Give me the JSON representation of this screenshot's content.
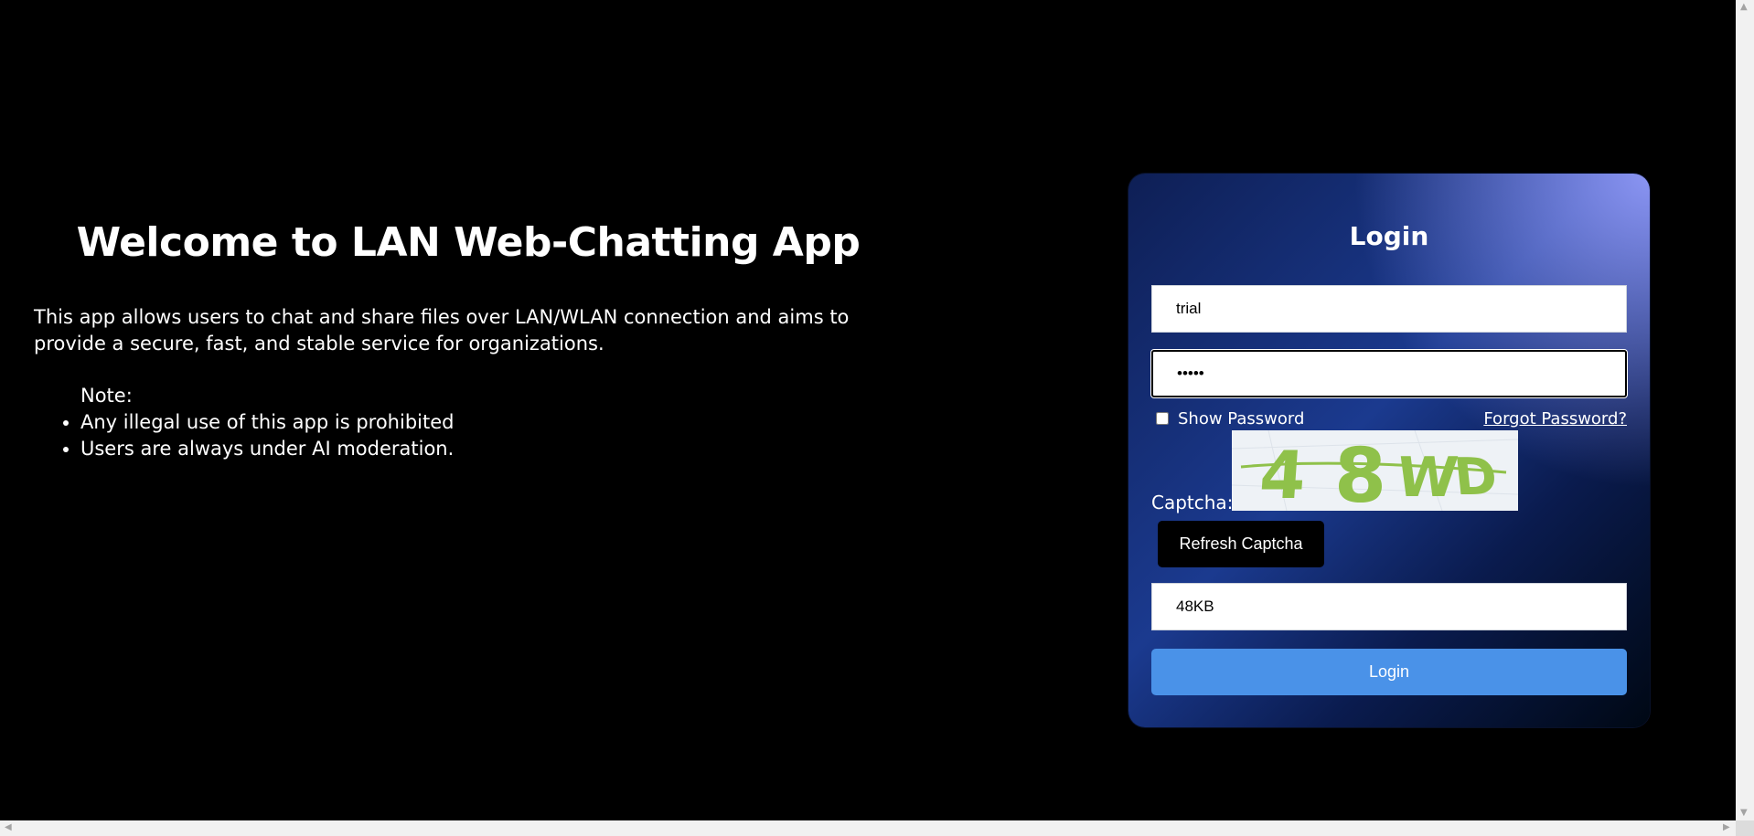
{
  "intro": {
    "title": "Welcome to LAN Web-Chatting App",
    "description": "This app allows users to chat and share files over LAN/WLAN connection and aims to provide a secure, fast, and stable service for organizations.",
    "note_title": "Note:",
    "notes": [
      "Any illegal use of this app is prohibited",
      "Users are always under AI moderation."
    ]
  },
  "login": {
    "title": "Login",
    "username_value": "trial",
    "password_value": "•••••",
    "show_password_label": "Show Password",
    "forgot_password_label": "Forgot Password?",
    "captcha_label": "Captcha:",
    "captcha_text": "4 8 WD",
    "refresh_captcha_label": "Refresh Captcha",
    "captcha_input_value": "48KB",
    "login_button_label": "Login"
  },
  "colors": {
    "background": "#000000",
    "login_button": "#4a92e8",
    "captcha_glyphs": "#8fc14a"
  }
}
